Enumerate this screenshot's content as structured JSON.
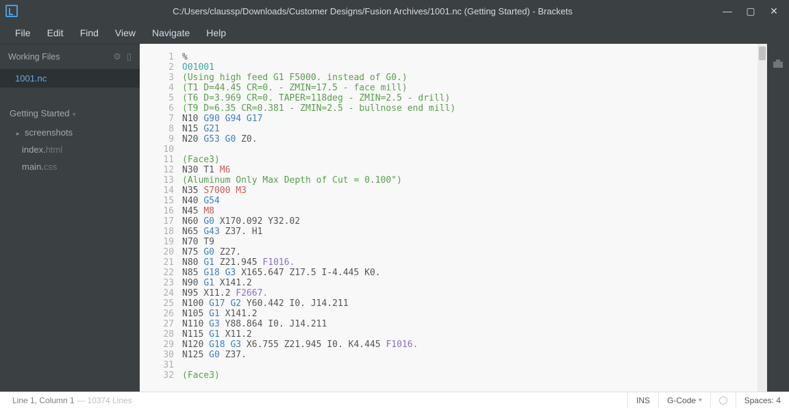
{
  "window": {
    "title": "C:/Users/claussp/Downloads/Customer Designs/Fusion Archives/1001.nc (Getting Started) - Brackets"
  },
  "menu": {
    "file": "File",
    "edit": "Edit",
    "find": "Find",
    "view": "View",
    "navigate": "Navigate",
    "help": "Help"
  },
  "sidebar": {
    "working_files_label": "Working Files",
    "working_files": [
      {
        "name": "1001.nc",
        "active": true
      }
    ],
    "project_name": "Getting Started",
    "tree": {
      "folder1": "screenshots",
      "file1_pre": "index.",
      "file1_ext": "html",
      "file2_pre": "main.",
      "file2_ext": "css"
    }
  },
  "editor": {
    "lines": [
      [
        [
          "",
          "%"
        ]
      ],
      [
        [
          "onum",
          "O01001"
        ]
      ],
      [
        [
          "cmt",
          "(Using high feed G1 F5000. instead of G0.)"
        ]
      ],
      [
        [
          "cmt",
          "(T1 D=44.45 CR=0. - ZMIN=17.5 - face mill)"
        ]
      ],
      [
        [
          "cmt",
          "(T6 D=3.969 CR=0. TAPER=118deg - ZMIN=2.5 - drill)"
        ]
      ],
      [
        [
          "cmt",
          "(T9 D=6.35 CR=0.381 - ZMIN=2.5 - bullnose end mill)"
        ]
      ],
      [
        [
          "",
          "N10 "
        ],
        [
          "g",
          "G90 G94 G17"
        ]
      ],
      [
        [
          "",
          "N15 "
        ],
        [
          "g",
          "G21"
        ]
      ],
      [
        [
          "",
          "N20 "
        ],
        [
          "g",
          "G53 G0"
        ],
        [
          "",
          " Z0."
        ]
      ],
      [
        [
          "",
          ""
        ]
      ],
      [
        [
          "cmt",
          "(Face3)"
        ]
      ],
      [
        [
          "",
          "N30 T1 "
        ],
        [
          "m",
          "M6"
        ]
      ],
      [
        [
          "cmt",
          "(Aluminum Only Max Depth of Cut = 0.100\")"
        ]
      ],
      [
        [
          "",
          "N35 "
        ],
        [
          "s",
          "S7000"
        ],
        [
          "",
          " "
        ],
        [
          "m",
          "M3"
        ]
      ],
      [
        [
          "",
          "N40 "
        ],
        [
          "g",
          "G54"
        ]
      ],
      [
        [
          "",
          "N45 "
        ],
        [
          "m",
          "M8"
        ]
      ],
      [
        [
          "",
          "N60 "
        ],
        [
          "g",
          "G0"
        ],
        [
          "",
          " X170.092 Y32.02"
        ]
      ],
      [
        [
          "",
          "N65 "
        ],
        [
          "g",
          "G43"
        ],
        [
          "",
          " Z37. H1"
        ]
      ],
      [
        [
          "",
          "N70 T9"
        ]
      ],
      [
        [
          "",
          "N75 "
        ],
        [
          "g",
          "G0"
        ],
        [
          "",
          " Z27."
        ]
      ],
      [
        [
          "",
          "N80 "
        ],
        [
          "g",
          "G1"
        ],
        [
          "",
          " Z21.945 "
        ],
        [
          "f",
          "F1016."
        ]
      ],
      [
        [
          "",
          "N85 "
        ],
        [
          "g",
          "G18 G3"
        ],
        [
          "",
          " X165.647 Z17.5 I-4.445 K0."
        ]
      ],
      [
        [
          "",
          "N90 "
        ],
        [
          "g",
          "G1"
        ],
        [
          "",
          " X141.2"
        ]
      ],
      [
        [
          "",
          "N95 X11.2 "
        ],
        [
          "f",
          "F2667."
        ]
      ],
      [
        [
          "",
          "N100 "
        ],
        [
          "g",
          "G17 G2"
        ],
        [
          "",
          " Y60.442 I0. J14.211"
        ]
      ],
      [
        [
          "",
          "N105 "
        ],
        [
          "g",
          "G1"
        ],
        [
          "",
          " X141.2"
        ]
      ],
      [
        [
          "",
          "N110 "
        ],
        [
          "g",
          "G3"
        ],
        [
          "",
          " Y88.864 I0. J14.211"
        ]
      ],
      [
        [
          "",
          "N115 "
        ],
        [
          "g",
          "G1"
        ],
        [
          "",
          " X11.2"
        ]
      ],
      [
        [
          "",
          "N120 "
        ],
        [
          "g",
          "G18 G3"
        ],
        [
          "",
          " X6.755 Z21.945 I0. K4.445 "
        ],
        [
          "f",
          "F1016."
        ]
      ],
      [
        [
          "",
          "N125 "
        ],
        [
          "g",
          "G0"
        ],
        [
          "",
          " Z37."
        ]
      ],
      [
        [
          "",
          ""
        ]
      ],
      [
        [
          "cmt",
          "(Face3)"
        ]
      ]
    ]
  },
  "status": {
    "cursor": "Line 1, Column 1",
    "total": "10374 Lines",
    "ins": "INS",
    "lang": "G-Code",
    "spaces": "Spaces: 4"
  }
}
